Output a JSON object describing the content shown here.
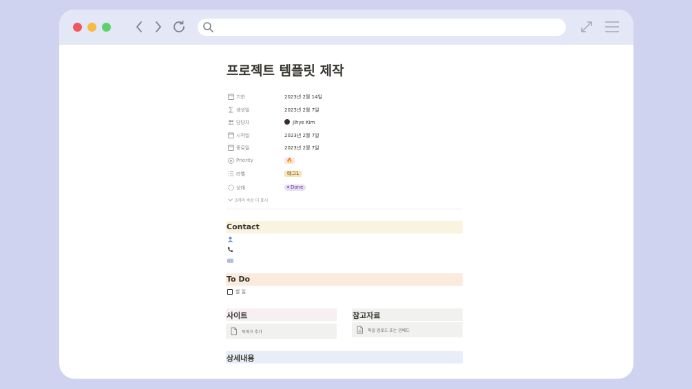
{
  "browser": {
    "url_value": "",
    "icons": {
      "back": "chevron-left-icon",
      "forward": "chevron-right-icon",
      "reload": "reload-icon",
      "search": "search-icon",
      "expand": "expand-icon",
      "menu": "hamburger-menu-icon"
    },
    "colors": {
      "background": "#cfd3f0",
      "titlebar": "#e4e7f6",
      "close": "#f0595c",
      "minimize": "#f6bb3f",
      "zoom": "#5bd36a"
    }
  },
  "page": {
    "title": "프로젝트 템플릿 제작",
    "properties": [
      {
        "icon": "calendar-icon",
        "name": "기한",
        "value": "2023년 2월 14일"
      },
      {
        "icon": "sigma-icon",
        "name": "생성일",
        "value": "2023년 2월 7일"
      },
      {
        "icon": "people-icon",
        "name": "담당자",
        "value": "Jihye Kim"
      },
      {
        "icon": "calendar-icon",
        "name": "시작일",
        "value": "2023년 2월 7일"
      },
      {
        "icon": "calendar-icon",
        "name": "종료일",
        "value": "2023년 2월 7일"
      },
      {
        "icon": "target-icon",
        "name": "Priority",
        "value": "🔥"
      },
      {
        "icon": "list-icon",
        "name": "라벨",
        "value": "태그1"
      },
      {
        "icon": "status-circle-icon",
        "name": "상태",
        "value": "Done"
      }
    ],
    "more_properties": "3개의 속성 더 표시",
    "contact": {
      "heading": "Contact",
      "icons": [
        "person-icon",
        "phone-icon",
        "id-card-icon"
      ]
    },
    "todo": {
      "heading": "To Do",
      "items": [
        "할 일"
      ]
    },
    "site": {
      "heading": "사이트",
      "callout": "북마크 추가"
    },
    "reference": {
      "heading": "참고자료",
      "callout": "파일 업로드 또는 임베드"
    },
    "details": {
      "heading": "상세내용"
    }
  }
}
